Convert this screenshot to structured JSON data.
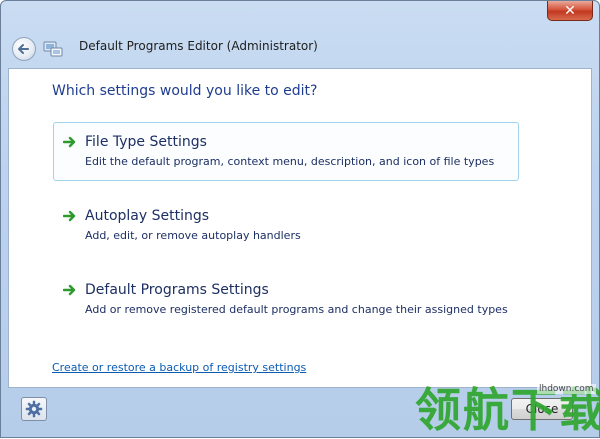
{
  "window": {
    "title": "Default Programs Editor (Administrator)",
    "close_glyph": "✕"
  },
  "main": {
    "heading": "Which settings would you like to edit?",
    "options": [
      {
        "title": "File Type Settings",
        "description": "Edit the default program, context menu, description, and icon of file types"
      },
      {
        "title": "Autoplay Settings",
        "description": "Add, edit, or remove autoplay handlers"
      },
      {
        "title": "Default Programs Settings",
        "description": "Add or remove registered default programs and change their assigned types"
      }
    ],
    "backup_link": "Create or restore a backup of registry settings"
  },
  "footer": {
    "close_label": "Close"
  },
  "watermark": {
    "text": "领航下载",
    "url": "lhdown.com"
  },
  "icons": {
    "back": "back-arrow-icon",
    "app": "app-icon",
    "option_arrow": "green-arrow-icon",
    "settings": "gear-icon"
  },
  "colors": {
    "heading": "#1e3d8f",
    "link": "#0b5bb3",
    "arrow": "#2e9a2e",
    "highlight_border": "#9fd4ec",
    "watermark": "#2fa62f"
  }
}
